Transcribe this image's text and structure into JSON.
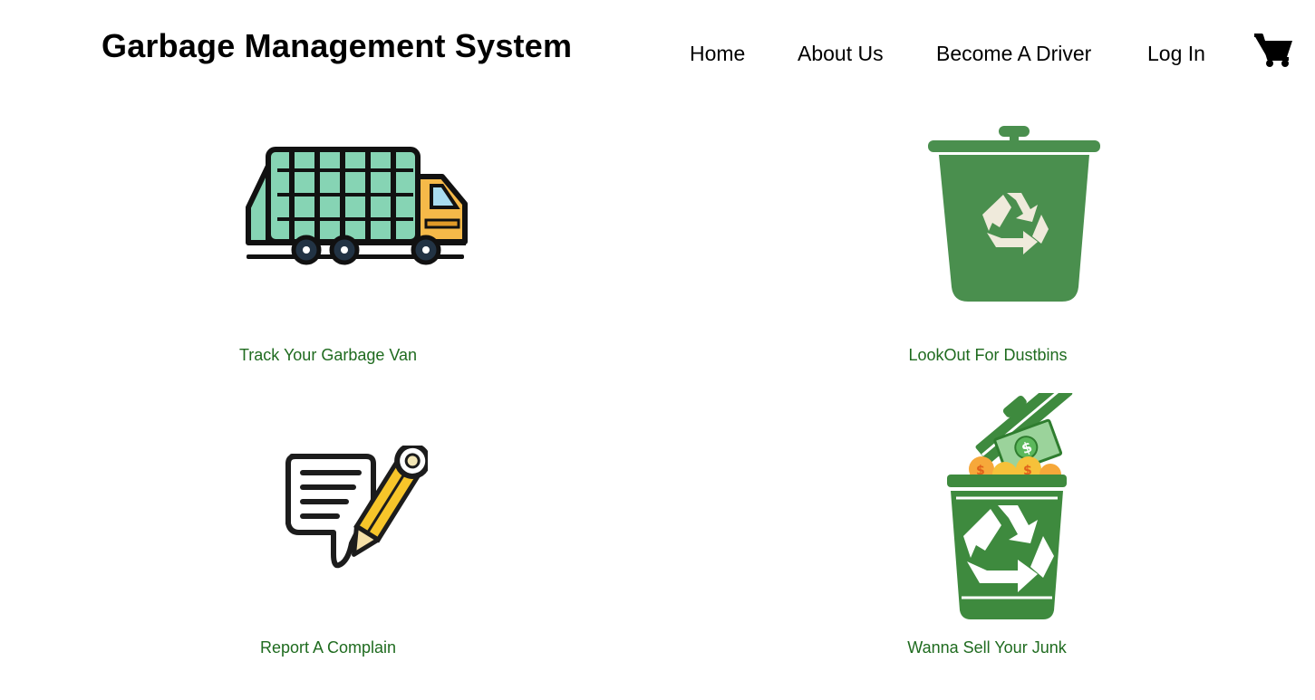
{
  "header": {
    "title": "Garbage Management System"
  },
  "nav": {
    "items": [
      {
        "label": "Home"
      },
      {
        "label": "About Us"
      },
      {
        "label": "Become A Driver"
      },
      {
        "label": "Log In"
      }
    ],
    "cart_icon": "shopping-cart-icon"
  },
  "features": [
    {
      "label": "Track Your Garbage Van",
      "icon": "garbage-truck-icon"
    },
    {
      "label": "LookOut For Dustbins",
      "icon": "recycle-bin-icon"
    },
    {
      "label": "Report A Complain",
      "icon": "complaint-pencil-icon"
    },
    {
      "label": "Wanna Sell Your Junk",
      "icon": "money-bin-icon"
    }
  ],
  "colors": {
    "label_green": "#1f6b1f",
    "bin_green": "#4a8f4e",
    "truck_mint": "#86d4b4",
    "truck_cab": "#f5b949",
    "pencil_yellow": "#f7c52a"
  }
}
